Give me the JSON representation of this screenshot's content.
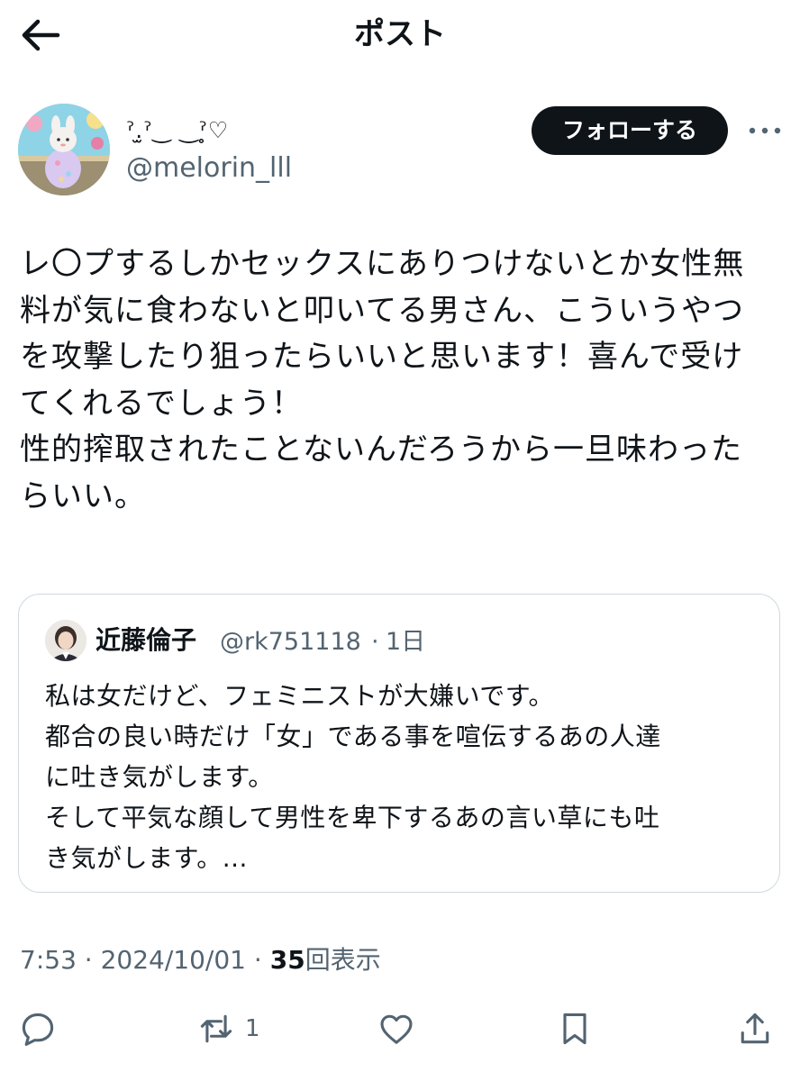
{
  "header": {
    "title": "ポスト",
    "back_icon": "arrow-left-icon"
  },
  "author": {
    "display_name": "ˀ.̫ˀ‿ ‿ˀ̥♡",
    "handle": "@melorin_lll",
    "follow_label": "フォローする",
    "more_icon": "more-horizontal-icon"
  },
  "post": {
    "text": "レ〇プするしかセックスにありつけないとか女性無\n料が気に食わないと叩いてる男さん、こういうやつ\nを攻撃したり狙ったらいいと思います！喜んで受け\nてくれるでしょう！\n性的搾取されたことないんだろうから一旦味わった\nらいい。"
  },
  "quote": {
    "name": "近藤倫子",
    "handle": "@rk751118",
    "separator": "·",
    "time": "1日",
    "text": "私は女だけど、フェミニストが大嫌いです。\n都合の良い時だけ「女」である事を喧伝するあの人達\nに吐き気がします。\nそして平気な顔して男性を卑下するあの言い草にも吐\nき気がします。..."
  },
  "meta": {
    "time": "7:53",
    "sep1": "·",
    "date": "2024/10/01",
    "sep2": "·",
    "views": "35",
    "views_label": "回表示"
  },
  "actions": {
    "reply_icon": "reply-icon",
    "retweet_icon": "retweet-icon",
    "retweet_count": "1",
    "like_icon": "heart-icon",
    "bookmark_icon": "bookmark-icon",
    "share_icon": "share-icon"
  },
  "colors": {
    "text": "#0f1419",
    "secondary": "#536471",
    "border": "#cfd9de",
    "button": "#0f1419"
  }
}
